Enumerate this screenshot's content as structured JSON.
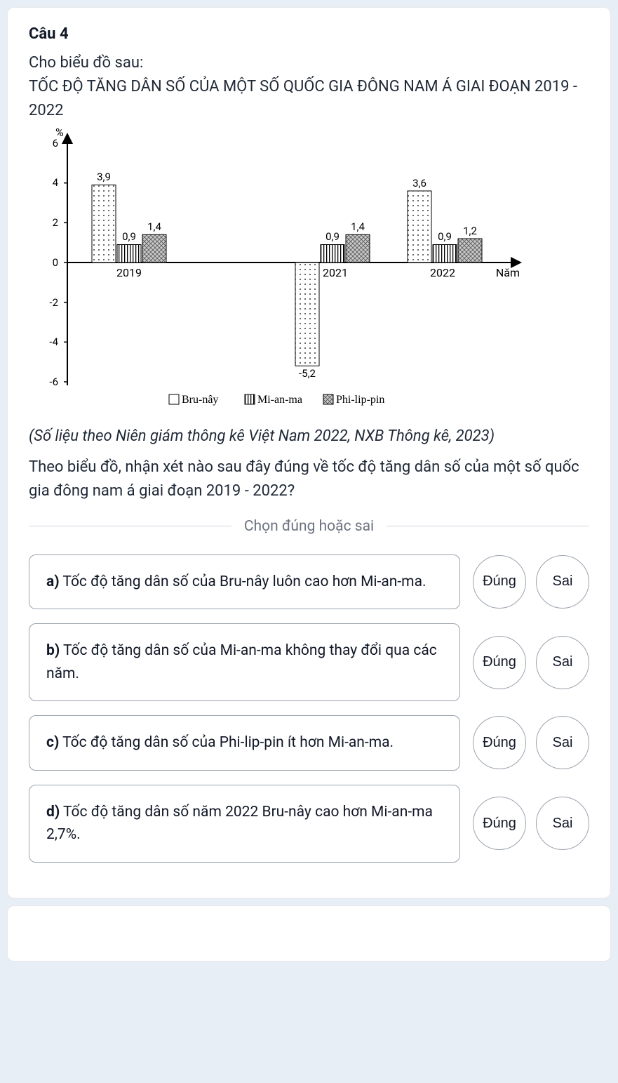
{
  "question": {
    "number": "Câu 4",
    "intro": "Cho biểu đồ sau:",
    "chart_title": "TỐC ĐỘ TĂNG DÂN SỐ CỦA MỘT SỐ QUỐC GIA ĐÔNG NAM Á GIAI ĐOẠN 2019 - 2022",
    "source": "(Số liệu theo Niên giám thông kê Việt Nam 2022, NXB Thông kê, 2023)",
    "prompt": "Theo biểu đồ, nhận xét nào sau đây đúng về tốc độ tăng dân số của một số quốc gia đông nam á giai đoạn 2019 - 2022?"
  },
  "instruction": "Chọn đúng hoặc sai",
  "buttons": {
    "true": "Đúng",
    "false": "Sai"
  },
  "options": {
    "a": {
      "label": "a)",
      "text": " Tốc độ tăng dân số của Bru-nây luôn cao hơn Mi-an-ma."
    },
    "b": {
      "label": "b)",
      "text": " Tốc độ tăng dân số của Mi-an-ma không thay đổi qua các năm."
    },
    "c": {
      "label": "c)",
      "text": " Tốc độ tăng dân số của Phi-lip-pin ít hơn Mi-an-ma."
    },
    "d": {
      "label": "d)",
      "text": " Tốc độ tăng dân số năm 2022 Bru-nây cao hơn Mi-an-ma 2,7%."
    }
  },
  "chart_data": {
    "type": "bar",
    "ylabel": "%",
    "xlabel": "Năm",
    "ylim": [
      -6,
      6
    ],
    "yticks": [
      -6,
      -4,
      -2,
      0,
      2,
      4,
      6
    ],
    "categories": [
      "2019",
      "2021",
      "2022"
    ],
    "series": [
      {
        "name": "Bru-nây",
        "values": [
          3.9,
          -5.2,
          3.6
        ]
      },
      {
        "name": "Mi-an-ma",
        "values": [
          0.9,
          0.9,
          0.9
        ]
      },
      {
        "name": "Phi-lip-pin",
        "values": [
          1.4,
          1.4,
          1.2
        ]
      }
    ],
    "value_labels": {
      "2019": [
        "3,9",
        "0,9",
        "1,4"
      ],
      "2021": [
        "-5,2",
        "0,9",
        "1,4"
      ],
      "2022": [
        "3,6",
        "0,9",
        "1,2"
      ]
    },
    "legend": [
      "Bru-nây",
      "Mi-an-ma",
      "Phi-lip-pin"
    ]
  }
}
